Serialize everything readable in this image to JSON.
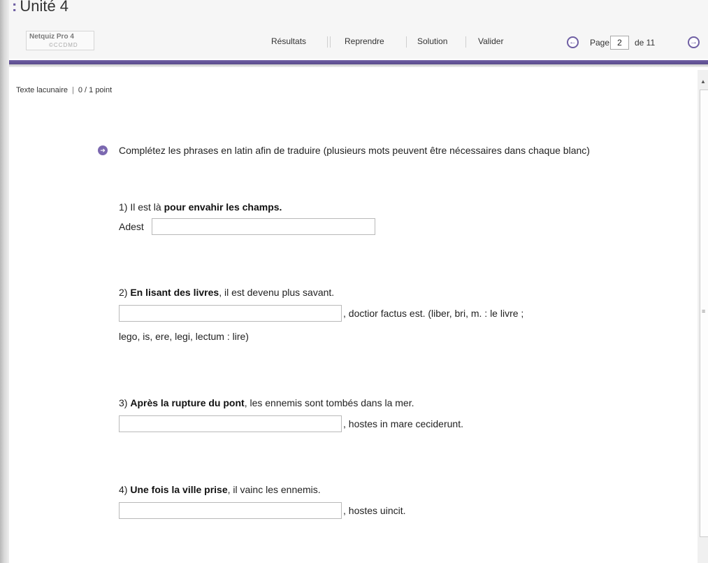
{
  "header": {
    "unit_title": "Unité 4",
    "title_marker": ":",
    "logo_line1": "Netquiz Pro 4",
    "logo_line2": "©CCDMD",
    "toolbar": {
      "results": "Résultats",
      "resume": "Reprendre",
      "solution": "Solution",
      "validate": "Valider"
    },
    "pagination": {
      "page_label": "Page",
      "current_page": "2",
      "of_label": "de 11"
    }
  },
  "breadcrumb": {
    "type": "Texte lacunaire",
    "separator": "|",
    "score": "0 / 1 point"
  },
  "question": {
    "instructions": "Complétez les phrases en latin afin de traduire (plusieurs mots peuvent être nécessaires dans chaque blanc)",
    "items": [
      {
        "number": "1)",
        "text_before": "Il est là",
        "bold": "pour envahir les champs.",
        "text_after": "",
        "answer_prefix": "Adest",
        "answer_value": "",
        "answer_suffix": ""
      },
      {
        "number": "2)",
        "text_before": "",
        "bold": "En lisant des livres",
        "text_after": ", il est devenu plus savant.",
        "answer_prefix": "",
        "answer_value": "",
        "answer_suffix": ", doctior factus est. (liber, bri, m. : le livre ;",
        "answer_suffix_line2": "lego, is, ere, legi, lectum : lire)"
      },
      {
        "number": "3)",
        "text_before": "",
        "bold": "Après la rupture du pont",
        "text_after": ", les ennemis sont tombés dans la mer.",
        "answer_prefix": "",
        "answer_value": "",
        "answer_suffix": ", hostes in mare ceciderunt."
      },
      {
        "number": "4)",
        "text_before": "",
        "bold": "Une fois la ville prise",
        "text_after": ", il vainc les ennemis.",
        "answer_prefix": "",
        "answer_value": "",
        "answer_suffix": ", hostes uincit."
      }
    ]
  },
  "icons": {
    "prev": "arrow-left-circle-icon",
    "next": "arrow-right-circle-icon",
    "bullet": "arrow-right-bullet-icon"
  },
  "colors": {
    "accent": "#6f5fa3",
    "header_bg": "#f6f6f6"
  }
}
